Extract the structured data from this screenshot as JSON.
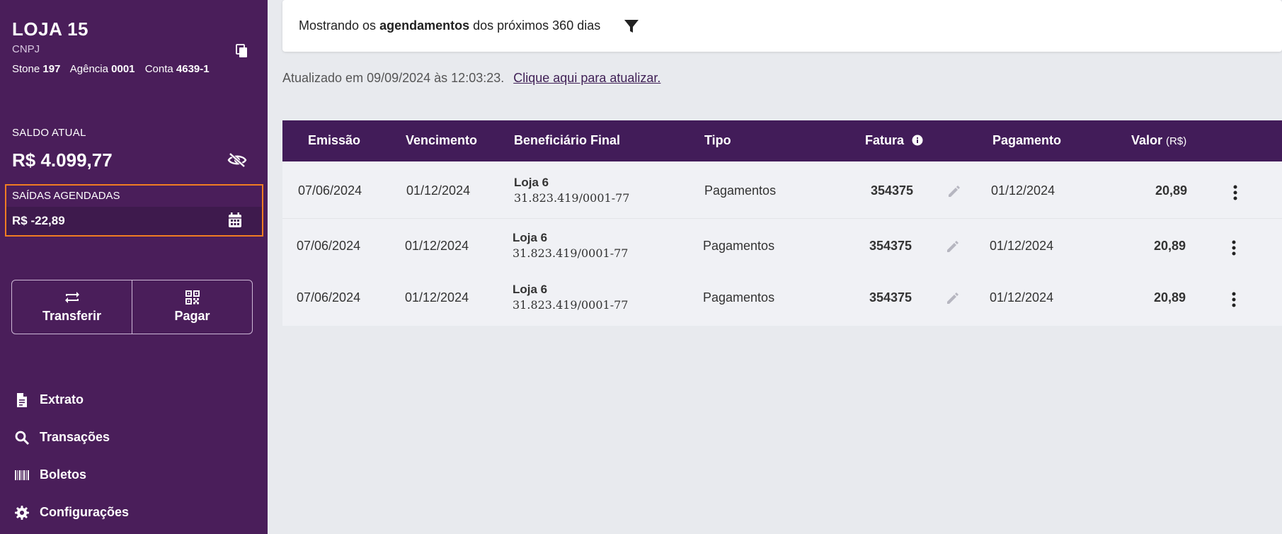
{
  "sidebar": {
    "store_name": "LOJA 15",
    "cnpj_label": "CNPJ",
    "bank": {
      "stone_label": "Stone",
      "stone_value": "197",
      "agencia_label": "Agência",
      "agencia_value": "0001",
      "conta_label": "Conta",
      "conta_value": "4639-1"
    },
    "balance_label": "SALDO ATUAL",
    "balance_value": "R$ 4.099,77",
    "scheduled_label": "SAÍDAS AGENDADAS",
    "scheduled_value": "R$ -22,89",
    "actions": [
      {
        "label": "Transferir",
        "icon": "transfer-icon"
      },
      {
        "label": "Pagar",
        "icon": "qr-code-icon"
      }
    ],
    "menu": [
      {
        "label": "Extrato",
        "icon": "document-icon"
      },
      {
        "label": "Transações",
        "icon": "search-icon"
      },
      {
        "label": "Boletos",
        "icon": "barcode-icon"
      },
      {
        "label": "Configurações",
        "icon": "gear-icon"
      }
    ]
  },
  "filter": {
    "prefix": "Mostrando os",
    "highlight": "agendamentos",
    "suffix": "dos próximos 360 dias"
  },
  "updated": {
    "text": "Atualizado em 09/09/2024 às 12:03:23.",
    "link": "Clique aqui para atualizar."
  },
  "table": {
    "headers": {
      "emissao": "Emissão",
      "vencimento": "Vencimento",
      "beneficiario": "Beneficiário Final",
      "tipo": "Tipo",
      "fatura": "Fatura",
      "pagamento": "Pagamento",
      "valor": "Valor",
      "valor_unit": "(R$)"
    },
    "rows": [
      {
        "emissao": "07/06/2024",
        "vencimento": "01/12/2024",
        "benef_name": "Loja 6",
        "benef_doc": "31.823.419/0001-77",
        "tipo": "Pagamentos",
        "fatura": "354375",
        "pagamento": "01/12/2024",
        "valor": "20,89"
      },
      {
        "emissao": "07/06/2024",
        "vencimento": "01/12/2024",
        "benef_name": "Loja 6",
        "benef_doc": "31.823.419/0001-77",
        "tipo": "Pagamentos",
        "fatura": "354375",
        "pagamento": "01/12/2024",
        "valor": "20,89"
      },
      {
        "emissao": "07/06/2024",
        "vencimento": "01/12/2024",
        "benef_name": "Loja 6",
        "benef_doc": "31.823.419/0001-77",
        "tipo": "Pagamentos",
        "fatura": "354375",
        "pagamento": "01/12/2024",
        "valor": "20,89"
      }
    ]
  },
  "colors": {
    "sidebar_bg": "#4a1e5a",
    "header_bg": "#421c59",
    "highlight_border": "#f07d22"
  }
}
